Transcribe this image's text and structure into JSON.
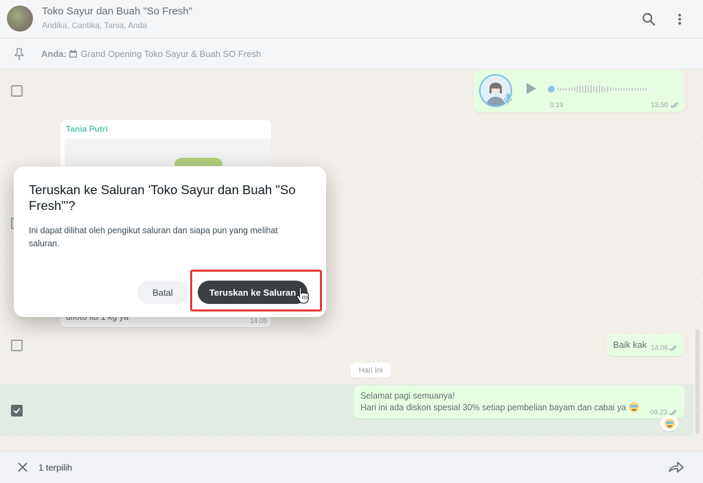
{
  "header": {
    "title": "Toko Sayur dan Buah \"So Fresh\"",
    "participants": "Andika, Cantika, Tania, Anda",
    "search_icon": "search-icon",
    "menu_icon": "more-vertical-icon"
  },
  "pinned": {
    "sender": "Anda:",
    "icon": "calendar-icon",
    "text": "Grand Opening Toko Sayur & Buah SO Fresh"
  },
  "messages": {
    "voice": {
      "duration": "0:19",
      "time": "13.50"
    },
    "tania": {
      "sender": "Tania Putri",
      "text_partial": "difoto itu 1 kg ya",
      "time": "14.05"
    },
    "baik": {
      "text": "Baik kak",
      "time": "14.06"
    },
    "day_divider": "Hari Ini",
    "promo": {
      "line1": "Selamat pagi semuanya!",
      "line2": "Hari ini ada diskon spesial 30% setiap pembelian bayam dan cabai ya",
      "time": "09.23"
    }
  },
  "dialog": {
    "title": "Teruskan ke Saluran 'Toko Sayur dan Buah \"So Fresh\"'?",
    "body": "Ini dapat dilihat oleh pengikut saluran dan siapa pun yang melihat saluran.",
    "cancel_label": "Batal",
    "confirm_label": "Teruskan ke Saluran"
  },
  "footer": {
    "selected_count": "1 terpilih",
    "close_icon": "close-icon",
    "forward_icon": "forward-icon"
  },
  "colors": {
    "outgoing_bubble": "#d9fdd3",
    "sender_name": "#06a884",
    "highlight": "#e53935",
    "confirm_button": "#3b3f42"
  }
}
